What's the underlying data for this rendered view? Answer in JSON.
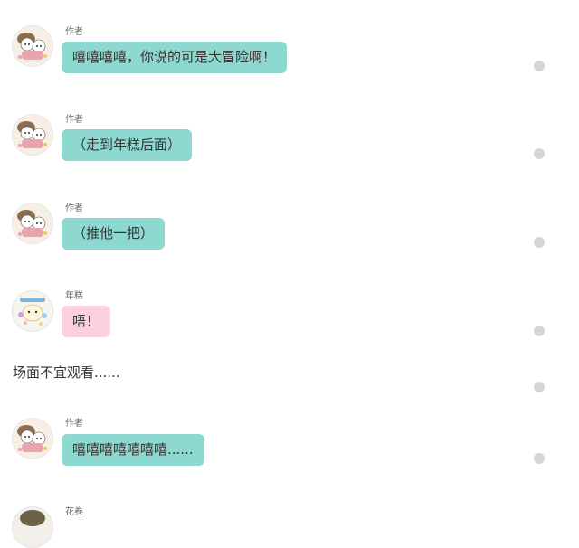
{
  "messages": [
    {
      "type": "chat",
      "speaker": "作者",
      "text": "嘻嘻嘻嘻，你说的可是大冒险啊！",
      "bubble": "teal",
      "avatar": "author-avatar"
    },
    {
      "type": "chat",
      "speaker": "作者",
      "text": "（走到年糕后面）",
      "bubble": "teal",
      "avatar": "author-avatar"
    },
    {
      "type": "chat",
      "speaker": "作者",
      "text": "（推他一把）",
      "bubble": "teal",
      "avatar": "author-avatar"
    },
    {
      "type": "chat",
      "speaker": "年糕",
      "text": "唔！",
      "bubble": "pink",
      "avatar": "niangao-avatar"
    },
    {
      "type": "narration",
      "text": "场面不宜观看......"
    },
    {
      "type": "chat",
      "speaker": "作者",
      "text": "嘻嘻嘻嘻嘻嘻嘻......",
      "bubble": "teal",
      "avatar": "author-avatar"
    },
    {
      "type": "chat",
      "speaker": "花卷",
      "text": "",
      "bubble": "teal",
      "avatar": "huajuan-avatar"
    }
  ],
  "colors": {
    "teal_bubble": "#8dd8cf",
    "pink_bubble": "#fcd0dc",
    "dot": "#d6d6d6"
  }
}
